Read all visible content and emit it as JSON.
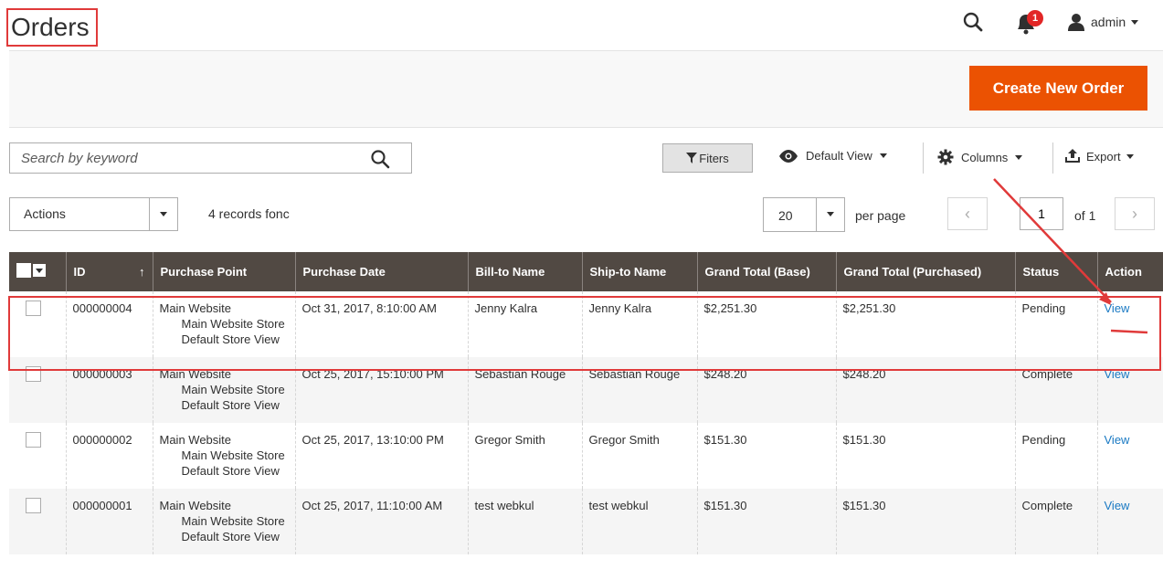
{
  "header": {
    "title": "Orders",
    "notification_count": "1",
    "user_name": "admin"
  },
  "toolbar": {
    "create_label": "Create New Order"
  },
  "search": {
    "placeholder": "Search by keyword"
  },
  "controls": {
    "filters_label": "Fiters",
    "view_label": "Default View",
    "columns_label": "Columns",
    "export_label": "Export"
  },
  "mass_actions": {
    "label": "Actions",
    "records_text": "4 records fonc"
  },
  "pager": {
    "per_page_value": "20",
    "per_page_label": "per page",
    "current_page": "1",
    "of_text": "of 1"
  },
  "columns": [
    "ID",
    "Purchase Point",
    "Purchase Date",
    "Bill-to Name",
    "Ship-to Name",
    "Grand Total (Base)",
    "Grand Total (Purchased)",
    "Status",
    "Action"
  ],
  "rows": [
    {
      "id": "000000004",
      "pp1": "Main Website",
      "pp2": "Main Website Store",
      "pp3": "Default Store View",
      "date": "Oct 31, 2017, 8:10:00 AM",
      "bill": "Jenny Kalra",
      "ship": "Jenny Kalra",
      "base": "$2,251.30",
      "purchased": "$2,251.30",
      "status": "Pending",
      "action": "View"
    },
    {
      "id": "000000003",
      "pp1": "Main Website",
      "pp2": "Main Website Store",
      "pp3": "Default Store View",
      "date": "Oct 25, 2017, 15:10:00 PM",
      "bill": "Sebastian Rouge",
      "ship": "Sebastian Rouge",
      "base": "$248.20",
      "purchased": "$248.20",
      "status": "Complete",
      "action": "View"
    },
    {
      "id": "000000002",
      "pp1": "Main Website",
      "pp2": "Main Website Store",
      "pp3": "Default Store View",
      "date": "Oct 25, 2017, 13:10:00 PM",
      "bill": "Gregor Smith",
      "ship": "Gregor Smith",
      "base": "$151.30",
      "purchased": "$151.30",
      "status": "Pending",
      "action": "View"
    },
    {
      "id": "000000001",
      "pp1": "Main Website",
      "pp2": "Main Website Store",
      "pp3": "Default Store View",
      "date": "Oct 25, 2017, 11:10:00 AM",
      "bill": "test webkul",
      "ship": "test webkul",
      "base": "$151.30",
      "purchased": "$151.30",
      "status": "Complete",
      "action": "View"
    }
  ],
  "colors": {
    "accent": "#eb5202",
    "table_header": "#514943",
    "link": "#1979c3",
    "annotation": "#e03a3a"
  }
}
